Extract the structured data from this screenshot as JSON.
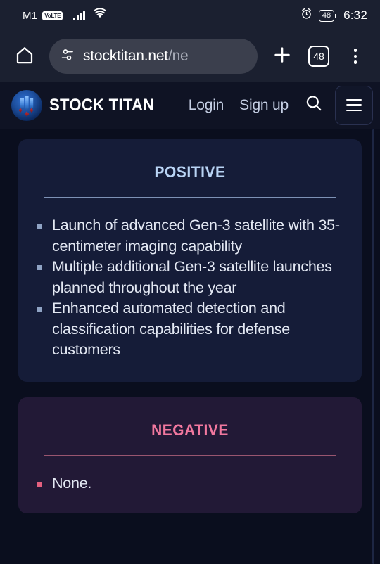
{
  "status_bar": {
    "carrier": "M1",
    "network_badge": "VoLTE",
    "signal_icon": "signal-bars-icon",
    "wifi_icon": "wifi-icon",
    "alarm_icon": "alarm-clock-icon",
    "battery_percent": "48",
    "time": "6:32"
  },
  "browser": {
    "home_icon": "home-icon",
    "site_settings_icon": "tune-icon",
    "url_visible": "stocktitan.net",
    "url_dim": "/ne",
    "new_tab_icon": "plus-icon",
    "tab_count": "48",
    "menu_icon": "three-dot-menu-icon"
  },
  "site_header": {
    "logo_icon": "stock-titan-logo-icon",
    "brand": "STOCK TITAN",
    "login_label": "Login",
    "signup_label": "Sign up",
    "search_icon": "search-icon",
    "hamburger_icon": "hamburger-menu-icon"
  },
  "content": {
    "positive": {
      "title": "Positive",
      "bullets": [
        "Launch of advanced Gen-3 satellite with 35-centimeter imaging capability",
        "Multiple additional Gen-3 satellite launches planned throughout the year",
        "Enhanced automated detection and classification capabilities for defense customers"
      ]
    },
    "negative": {
      "title": "Negative",
      "bullets": [
        "None."
      ]
    }
  },
  "colors": {
    "positive_accent": "#b9d4f5",
    "negative_accent": "#f2789f",
    "positive_card_bg": "#151c38",
    "negative_card_bg": "#221936",
    "page_bg": "#0a0e1e",
    "chrome_bg": "#1b2030"
  }
}
